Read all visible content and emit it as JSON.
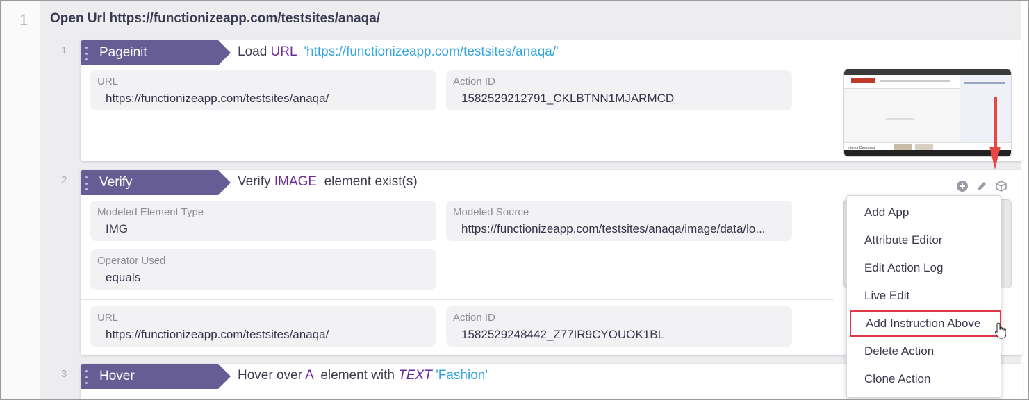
{
  "step": {
    "number": "1",
    "title": "Open Url https://functionizeapp.com/testsites/anaqa/"
  },
  "rows": [
    {
      "number": "1",
      "tag": "Pageinit",
      "desc": {
        "prefix": "Load ",
        "keyword": "URL",
        "space": "  ",
        "string": "'https://functionizeapp.com/testsites/anaqa/'"
      },
      "fields": [
        {
          "label": "URL",
          "value": "https://functionizeapp.com/testsites/anaqa/"
        },
        {
          "label": "Action ID",
          "value": "1582529212791_CKLBTNN1MJARMCD"
        }
      ]
    },
    {
      "number": "2",
      "tag": "Verify",
      "desc": {
        "prefix": "Verify ",
        "keyword": "IMAGE",
        "suffix": "  element exist(s)"
      },
      "fields": [
        {
          "label": "Modeled Element Type",
          "value": "IMG"
        },
        {
          "label": "Modeled Source",
          "value": "https://functionizeapp.com/testsites/anaqa/image/data/lo..."
        },
        {
          "label": "Operator Used",
          "value": "equals"
        },
        {
          "label": "URL",
          "value": "https://functionizeapp.com/testsites/anaqa/"
        },
        {
          "label": "Action ID",
          "value": "1582529248442_Z77IR9CYOUOK1BL"
        }
      ]
    },
    {
      "number": "3",
      "tag": "Hover",
      "desc": {
        "prefix": "Hover over ",
        "keyword": "A",
        "middle": "  element with ",
        "italic": "TEXT",
        "string": "'Fashion'"
      }
    }
  ],
  "thumbnail": {
    "logo_text": "Digital",
    "caption": "Interior Designing"
  },
  "icons": {
    "add": "plus-circle-icon",
    "edit": "pencil-icon",
    "cube": "cube-icon"
  },
  "context_menu": {
    "items": [
      "Add App",
      "Attribute Editor",
      "Edit Action Log",
      "Live Edit",
      "Add Instruction Above",
      "Delete Action",
      "Clone Action"
    ],
    "highlighted_index": 4
  },
  "colors": {
    "tag_bg": "#655d93",
    "keyword": "#6a2a9c",
    "string": "#33a6dd",
    "highlight_border": "#e0394a",
    "arrow": "#e84545"
  }
}
